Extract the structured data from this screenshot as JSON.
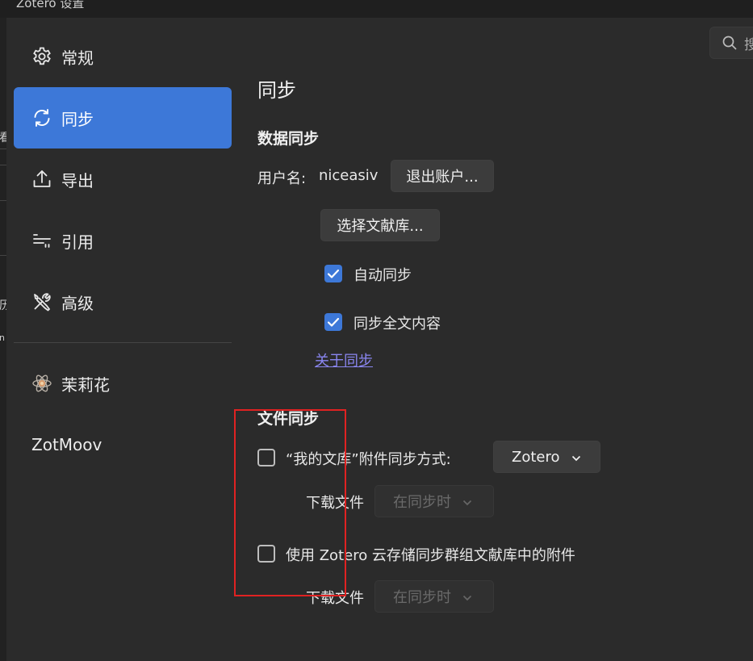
{
  "window": {
    "title": "Zotero 设置"
  },
  "left_fragments": [
    "看",
    "历",
    "n"
  ],
  "search": {
    "placeholder": "搜"
  },
  "sidebar": {
    "items": [
      {
        "label": "常规",
        "icon": "gear-icon",
        "active": false
      },
      {
        "label": "同步",
        "icon": "sync-icon",
        "active": true
      },
      {
        "label": "导出",
        "icon": "export-icon",
        "active": false
      },
      {
        "label": "引用",
        "icon": "cite-icon",
        "active": false
      },
      {
        "label": "高级",
        "icon": "tools-icon",
        "active": false
      },
      {
        "label": "茉莉花",
        "icon": "jasmine-icon",
        "active": false
      },
      {
        "label": "ZotMoov",
        "icon": "",
        "active": false
      }
    ]
  },
  "main": {
    "page_title": "同步",
    "data_sync": {
      "heading": "数据同步",
      "username_label": "用户名:",
      "username_value": "niceasiv",
      "logout_button": "退出账户...",
      "choose_library_button": "选择文献库...",
      "auto_sync": {
        "label": "自动同步",
        "checked": true
      },
      "fulltext_sync": {
        "label": "同步全文内容",
        "checked": true
      },
      "about_link": "关于同步"
    },
    "file_sync": {
      "heading": "文件同步",
      "my_library": {
        "label": "“我的文库”附件同步方式:",
        "checked": false,
        "method": "Zotero"
      },
      "download_label_1": "下载文件",
      "download_value_1": "在同步时",
      "group_libraries": {
        "label": "使用 Zotero 云存储同步群组文献库中的附件",
        "checked": false
      },
      "download_label_2": "下载文件",
      "download_value_2": "在同步时"
    }
  },
  "colors": {
    "accent": "#3d78d8",
    "link": "#8a86f0",
    "highlight_box": "#e02222"
  }
}
